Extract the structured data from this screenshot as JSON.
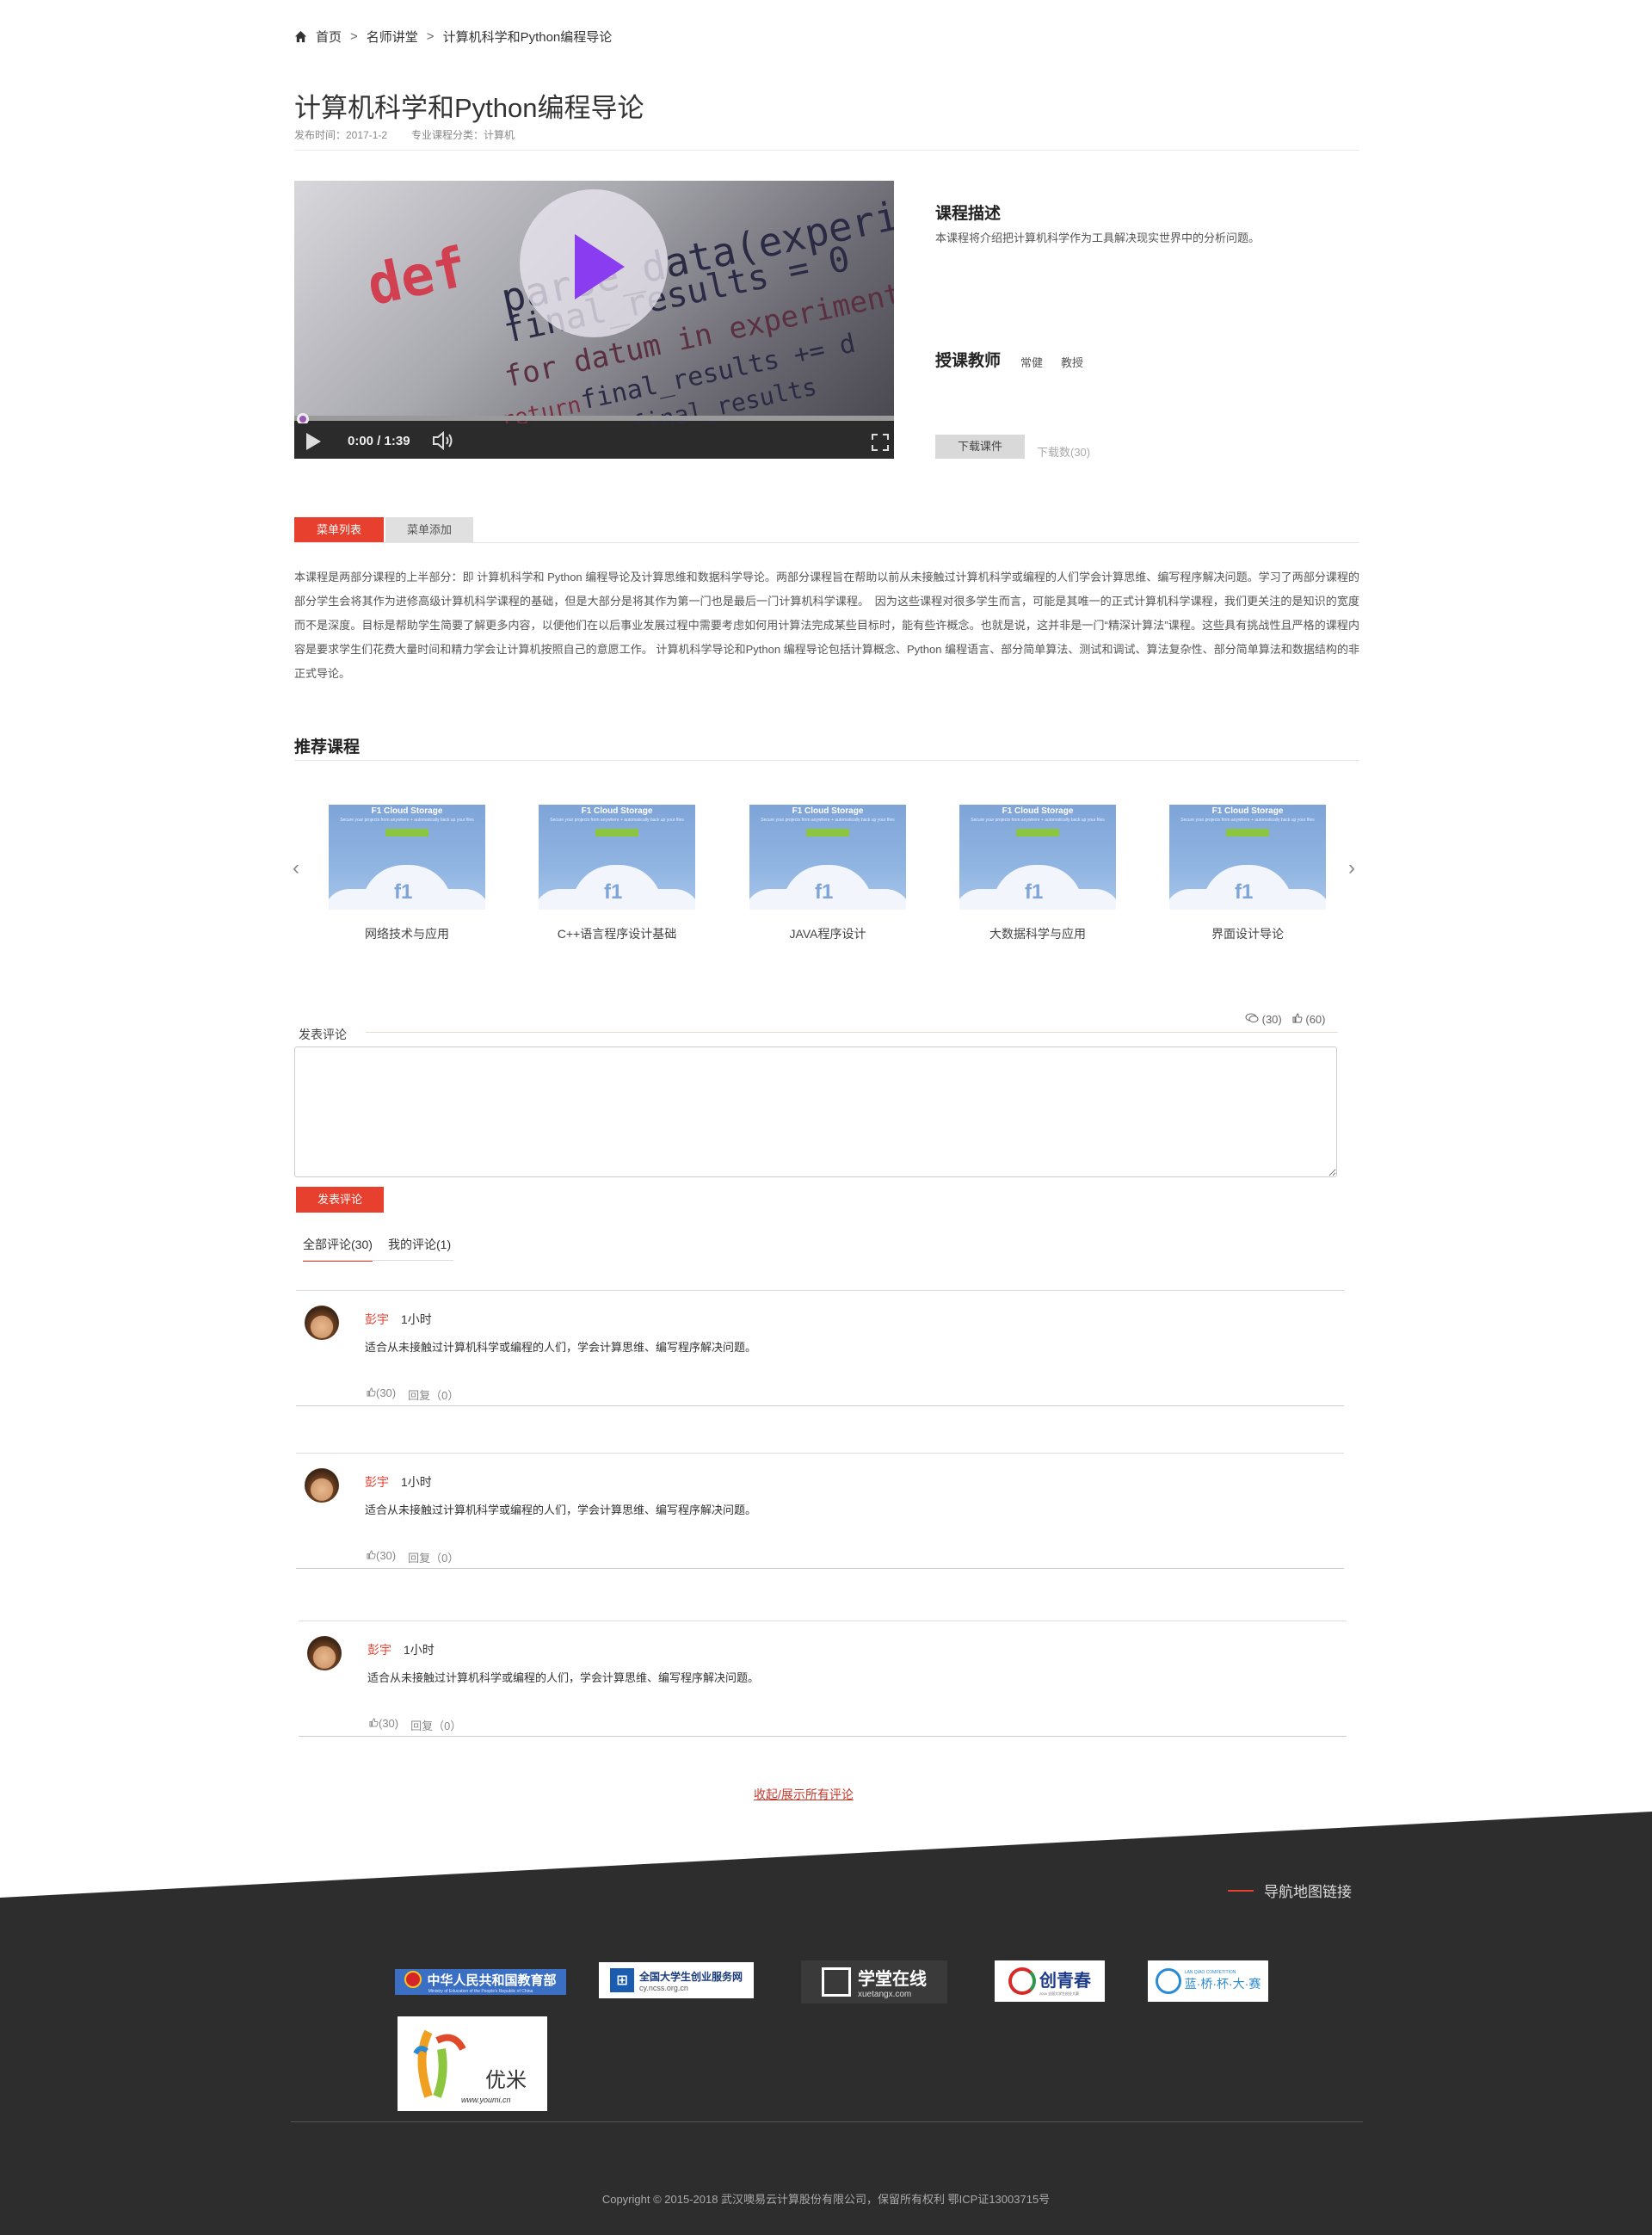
{
  "breadcrumb": {
    "home": "首页",
    "sep": ">",
    "level2": "名师讲堂",
    "level3": "计算机科学和Python编程导论"
  },
  "course": {
    "title": "计算机科学和Python编程导论",
    "publish_time": "发布时间：2017-1-2",
    "category": "专业课程分类：计算机",
    "video_time": "0:00 / 1:39",
    "desc_title": "课程描述",
    "desc_text": "本课程将介绍把计算机科学作为工具解决现实世界中的分析问题。",
    "teacher_title": "授课教师",
    "teacher_name": "常健",
    "teacher_rank": "教授",
    "download_label": "下载课件",
    "download_count": "下载数(30)"
  },
  "video_code": [
    "def",
    "parse_data(experiment",
    "final_results = 0",
    "for datum in experiment",
    "final_results += d",
    "final_results",
    "return"
  ],
  "tabs": {
    "active": "菜单列表",
    "inactive": "菜单添加"
  },
  "intro": "本课程是两部分课程的上半部分：即 计算机科学和 Python 编程导论及计算思维和数据科学导论。两部分课程旨在帮助以前从未接触过计算机科学或编程的人们学会计算思维、编写程序解决问题。学习了两部分课程的部分学生会将其作为进修高级计算机科学课程的基础，但是大部分是将其作为第一门也是最后一门计算机科学课程。　因为这些课程对很多学生而言，可能是其唯一的正式计算机科学课程，我们更关注的是知识的宽度而不是深度。目标是帮助学生简要了解更多内容，以便他们在以后事业发展过程中需要考虑如何用计算法完成某些目标时，能有些许概念。也就是说，这并非是一门“精深计算法”课程。这些具有挑战性且严格的课程内容是要求学生们花费大量时间和精力学会让计算机按照自己的意愿工作。 计算机科学导论和Python 编程导论包括计算概念、Python 编程语言、部分简单算法、测试和调试、算法复杂性、部分简单算法和数据结构的非正式导论。",
  "recommend": {
    "title": "推荐课程",
    "prev": "‹",
    "next": "›",
    "thumb_title": "F1 Cloud Storage",
    "thumb_sub": "Secure your projects from anywhere + automatically back up your files",
    "thumb_logo": "f1",
    "items": [
      "网络技术与应用",
      "C++语言程序设计基础",
      "JAVA程序设计",
      "大数据科学与应用",
      "界面设计导论"
    ]
  },
  "comments_section": {
    "stats_comments": "(30)",
    "stats_likes": "(60)",
    "label": "发表评论",
    "post_button": "发表评论",
    "tab_all": "全部评论(30)",
    "tab_mine": "我的评论(1)",
    "toggle": "收起/展示所有评论",
    "items": [
      {
        "user": "彭宇",
        "time": "1小时",
        "text": "适合从未接触过计算机科学或编程的人们，学会计算思维、编写程序解决问题。",
        "likes": "(30)",
        "reply": "回复（0）"
      },
      {
        "user": "彭宇",
        "time": "1小时",
        "text": "适合从未接触过计算机科学或编程的人们，学会计算思维、编写程序解决问题。",
        "likes": "(30)",
        "reply": "回复（0）"
      },
      {
        "user": "彭宇",
        "time": "1小时",
        "text": "适合从未接触过计算机科学或编程的人们，学会计算思维、编写程序解决问题。",
        "likes": "(30)",
        "reply": "回复（0）"
      }
    ]
  },
  "footer": {
    "nav_link": "导航地图链接",
    "logos": {
      "moe": "中华人民共和国教育部",
      "moe_sub": "Ministry of Education of the People's Republic of China",
      "ncss": "全国大学生创业服务网",
      "ncss_sub": "cy.ncss.org.cn",
      "xuetang": "学堂在线",
      "xuetang_sub": "xuetangx.com",
      "cqc": "创青春",
      "cqc_sub": "2016 全国大学生创业大赛",
      "lanqiao": "蓝·桥·杯·大·赛",
      "lanqiao_sub": "LAN QIAO COMPETITION",
      "youmi": "优米",
      "youmi_sub": "www.youmi.cn"
    },
    "copyright": "Copyright © 2015-2018 武汉噢易云计算股份有限公司，保留所有权利 鄂ICP证13003715号"
  },
  "colors": {
    "accent": "#e8402f",
    "footer_bg": "#2d2d2d",
    "play": "#8a3cf0"
  }
}
